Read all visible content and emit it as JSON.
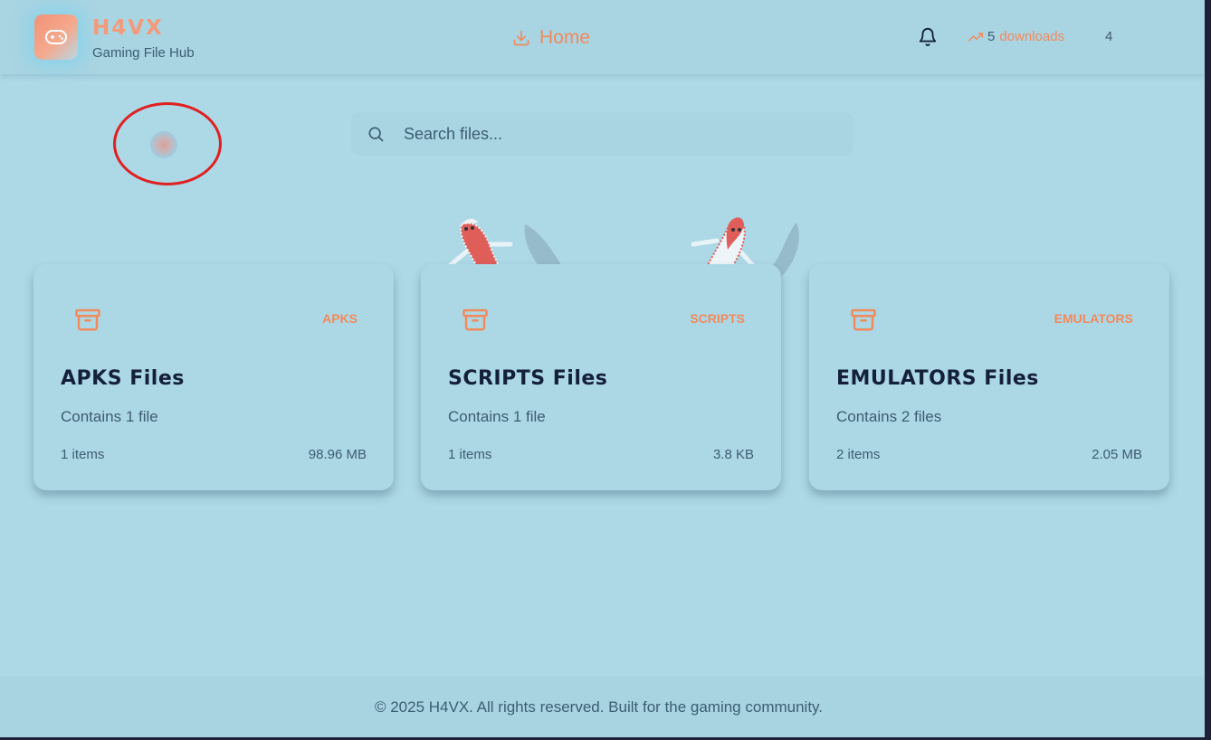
{
  "brand": {
    "title": "H4VX",
    "subtitle": "Gaming File Hub",
    "logo_icon": "gamepad-icon"
  },
  "nav": {
    "home_label": "Home",
    "home_icon": "download-icon"
  },
  "header_right": {
    "bell_icon": "bell-icon",
    "downloads_count": "5",
    "downloads_label": "downloads",
    "trend_icon": "trending-up-icon",
    "number": "4"
  },
  "search": {
    "placeholder": "Search files...",
    "value": ""
  },
  "cards": [
    {
      "tag": "APKS",
      "title": "APKS Files",
      "description": "Contains 1 file",
      "items": "1 items",
      "size": "98.96 MB",
      "icon": "archive-icon"
    },
    {
      "tag": "SCRIPTS",
      "title": "SCRIPTS Files",
      "description": "Contains 1 file",
      "items": "1 items",
      "size": "3.8 KB",
      "icon": "archive-icon"
    },
    {
      "tag": "EMULATORS",
      "title": "EMULATORS Files",
      "description": "Contains 2 files",
      "items": "2 items",
      "size": "2.05 MB",
      "icon": "archive-icon"
    }
  ],
  "footer": {
    "text": "© 2025 H4VX. All rights reserved. Built for the gaming community."
  },
  "colors": {
    "background": "#add8e6",
    "accent": "#f28a5c",
    "text_dark": "#14203a",
    "text_muted": "#3d5d72",
    "annotation": "#e02020"
  }
}
